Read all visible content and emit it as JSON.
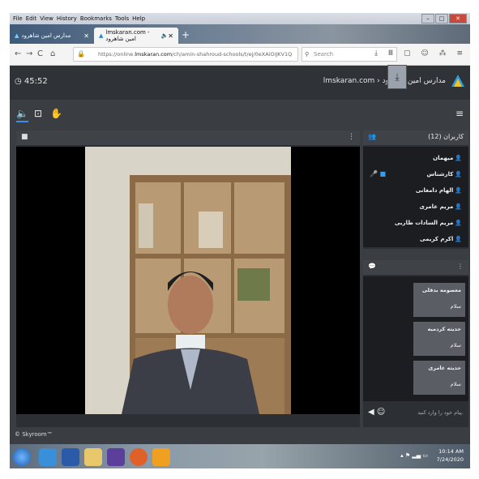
{
  "browser": {
    "menu": [
      "File",
      "Edit",
      "View",
      "History",
      "Bookmarks",
      "Tools",
      "Help"
    ],
    "tabs": [
      {
        "label": "مدارس امین شاهرود"
      },
      {
        "label": "lmskaran.com - امین شاهرود"
      }
    ],
    "url_prefix": "https://online.",
    "url_domain": "lmskaran.com",
    "url_rest": "/ch/amin-shahroud-schools/t/ej/0eXAiOiJKV1Q",
    "search_placeholder": "Search"
  },
  "header": {
    "timer": "45:52",
    "breadcrumb": "lmskaran.com › مدارس امین شاهرود"
  },
  "users": {
    "title": "کاربران (12)",
    "items": [
      {
        "name": "میهمان"
      },
      {
        "name": "کارشناس"
      },
      {
        "name": "الهام دامغانی"
      },
      {
        "name": "مریم عامری"
      },
      {
        "name": "مریم السادات طاربی"
      },
      {
        "name": "اکرم کریمی"
      }
    ]
  },
  "chat": {
    "messages": [
      {
        "author": "معصومه بدقلی",
        "text": "سلام"
      },
      {
        "author": "حدیثه کردمیه",
        "text": "سلام"
      },
      {
        "author": "حدیثه عامری",
        "text": "سلام"
      }
    ],
    "input_placeholder": "پیام خود را وارد کنید."
  },
  "footer": {
    "brand": "© Skyroom™"
  },
  "taskbar": {
    "time": "10:14 AM",
    "date": "7/24/2020"
  },
  "colors": {
    "accent": "#3b8fe0",
    "panel": "#2c2f33",
    "bg": "#3a3d42"
  }
}
